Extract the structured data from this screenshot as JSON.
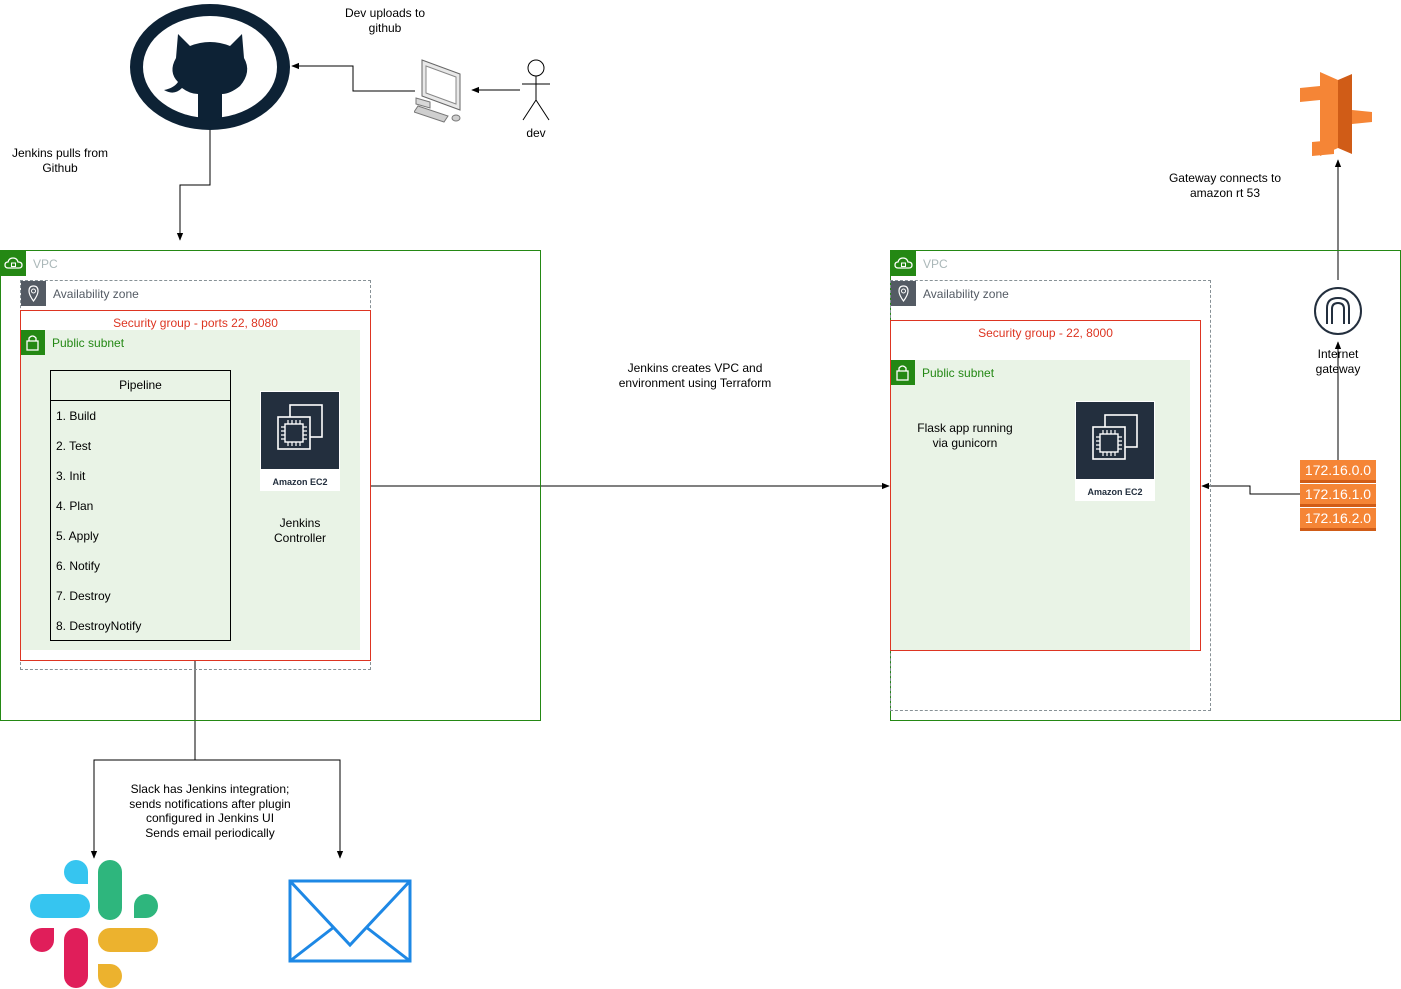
{
  "labels": {
    "dev_uploads": "Dev uploads to github",
    "dev": "dev",
    "jenkins_pulls": "Jenkins pulls from Github",
    "gateway_connects": "Gateway connects to amazon rt 53",
    "jenkins_creates": "Jenkins creates VPC and environment using Terraform",
    "slack_note_1": "Slack has Jenkins integration;",
    "slack_note_2": "sends notifications after plugin",
    "slack_note_3": "configured in Jenkins UI",
    "slack_note_4": "Sends email periodically"
  },
  "left_vpc": {
    "vpc_label": "VPC",
    "az_label": "Availability zone",
    "sg_label": "Security group - ports 22, 8080",
    "subnet_label": "Public subnet",
    "ec2_label": "Amazon EC2",
    "controller_label_1": "Jenkins",
    "controller_label_2": "Controller",
    "pipeline": {
      "title": "Pipeline",
      "steps": [
        "1. Build",
        "2. Test",
        "3. Init",
        "4. Plan",
        "5. Apply",
        "6. Notify",
        "7. Destroy",
        "8. DestroyNotify"
      ]
    }
  },
  "right_vpc": {
    "vpc_label": "VPC",
    "az_label": "Availability zone",
    "sg_label": "Security group - 22, 8000",
    "subnet_label": "Public subnet",
    "ec2_label": "Amazon EC2",
    "flask_label_1": "Flask app running",
    "flask_label_2": "via gunicorn",
    "igw_label_1": "Internet",
    "igw_label_2": "gateway",
    "ip_ranges": [
      "172.16.0.0",
      "172.16.1.0",
      "172.16.2.0"
    ]
  },
  "icons": [
    "github-icon",
    "desktop-computer-icon",
    "person-icon",
    "route53-icon",
    "internet-gateway-icon",
    "ec2-icon",
    "slack-icon",
    "email-icon",
    "vpc-cloud-icon",
    "availability-zone-pin-icon",
    "lock-icon"
  ],
  "colors": {
    "vpc_border": "#248814",
    "security_group": "#dd3522",
    "subnet_fill": "#e9f3e6",
    "ec2_fill": "#232f3e",
    "aws_orange": "#f58536",
    "github": "#0d2235",
    "email_blue": "#1e88e5"
  }
}
